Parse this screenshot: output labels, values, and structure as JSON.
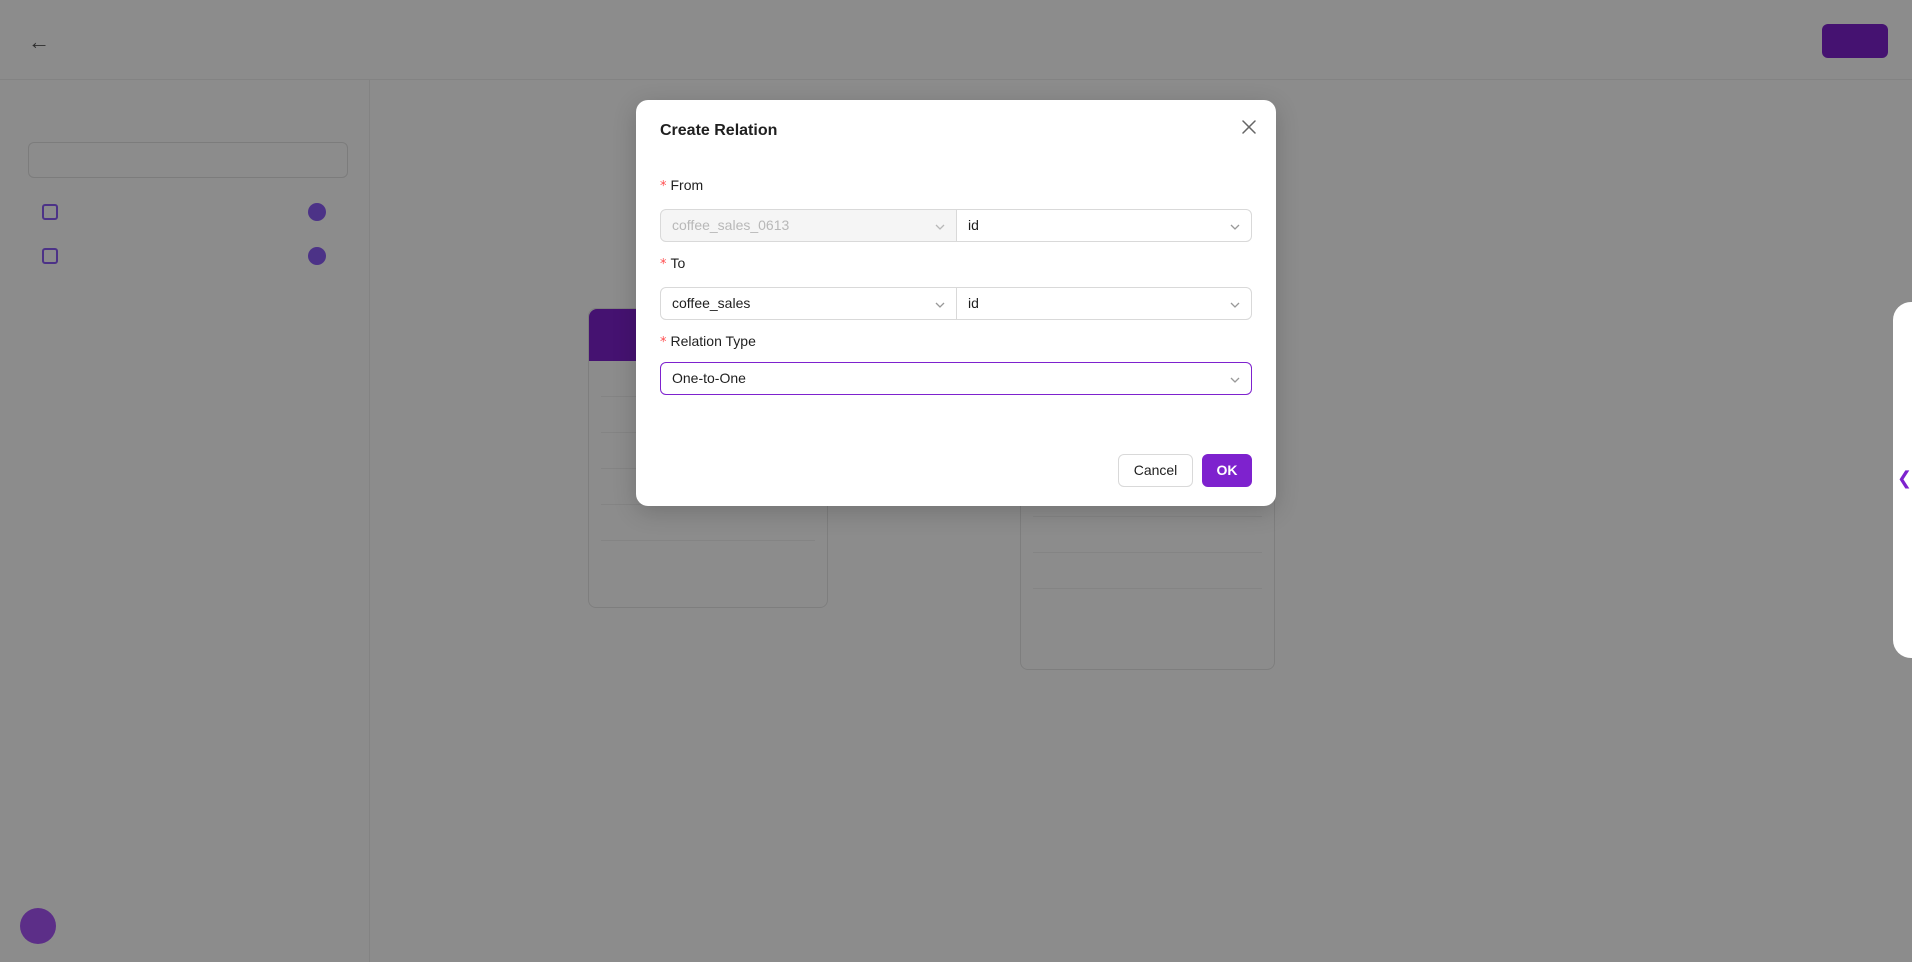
{
  "app": {
    "title": "",
    "toolbar": {
      "action_one": "",
      "action_two": "",
      "primary": ""
    },
    "sidebar": {
      "title": "",
      "items": [
        {
          "label": ""
        },
        {
          "label": ""
        }
      ]
    }
  },
  "modal": {
    "title": "Create Relation",
    "from": {
      "label": "From",
      "table_value": "coffee_sales_0613",
      "field_value": "id"
    },
    "to": {
      "label": "To",
      "table_value": "coffee_sales",
      "field_value": "id"
    },
    "relation_type": {
      "label": "Relation Type",
      "value": "One-to-One"
    },
    "required_mark": "*",
    "buttons": {
      "cancel": "Cancel",
      "ok": "OK"
    }
  },
  "colors": {
    "accent": "#7e22ce",
    "required": "#ff4d4f",
    "overlay": "rgba(0,0,0,0.45)"
  },
  "icons": {
    "close": "close-icon",
    "dropdown": "chevron-down-icon",
    "panel_toggle": "chevron-left-icon"
  }
}
